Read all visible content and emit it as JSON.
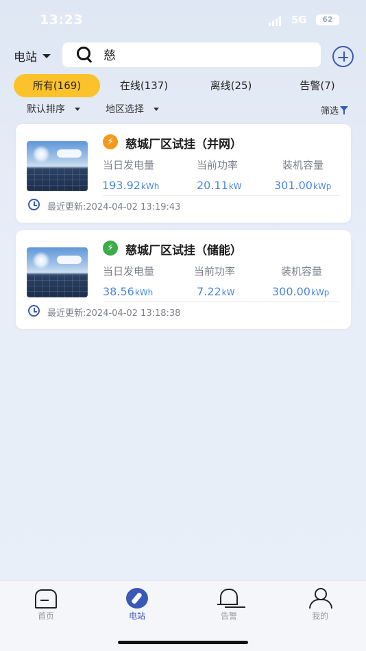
{
  "status_bar": {
    "time": "13:23",
    "network": "5G",
    "battery": "62"
  },
  "header": {
    "station_select_label": "电站",
    "search_value": "慈"
  },
  "tabs": [
    {
      "label": "所有(169)",
      "active": true
    },
    {
      "label": "在线(137)",
      "active": false
    },
    {
      "label": "离线(25)",
      "active": false
    },
    {
      "label": "告警(7)",
      "active": false
    }
  ],
  "filters": {
    "sort_label": "默认排序",
    "region_label": "地区选择",
    "filter_label": "筛选"
  },
  "stations": [
    {
      "name": "慈城厂区试挂（并网）",
      "badge_color": "#f39a1e",
      "badge_icon": "lightning-icon",
      "metrics": [
        {
          "label": "当日发电量",
          "value": "193.92",
          "unit": "kWh"
        },
        {
          "label": "当前功率",
          "value": "20.11",
          "unit": "kW"
        },
        {
          "label": "装机容量",
          "value": "301.00",
          "unit": "kWp"
        }
      ],
      "updated": "最近更新:2024-04-02 13:19:43"
    },
    {
      "name": "慈城厂区试挂（储能）",
      "badge_color": "#3cab4a",
      "badge_icon": "lightning-icon",
      "metrics": [
        {
          "label": "当日发电量",
          "value": "38.56",
          "unit": "kWh"
        },
        {
          "label": "当前功率",
          "value": "7.22",
          "unit": "kW"
        },
        {
          "label": "装机容量",
          "value": "300.00",
          "unit": "kWp"
        }
      ],
      "updated": "最近更新:2024-04-02 13:18:38"
    }
  ],
  "bottom_nav": [
    {
      "label": "首页",
      "icon": "home-icon",
      "active": false
    },
    {
      "label": "电站",
      "icon": "compass-icon",
      "active": true
    },
    {
      "label": "告警",
      "icon": "bell-icon",
      "active": false
    },
    {
      "label": "我的",
      "icon": "user-icon",
      "active": false
    }
  ]
}
